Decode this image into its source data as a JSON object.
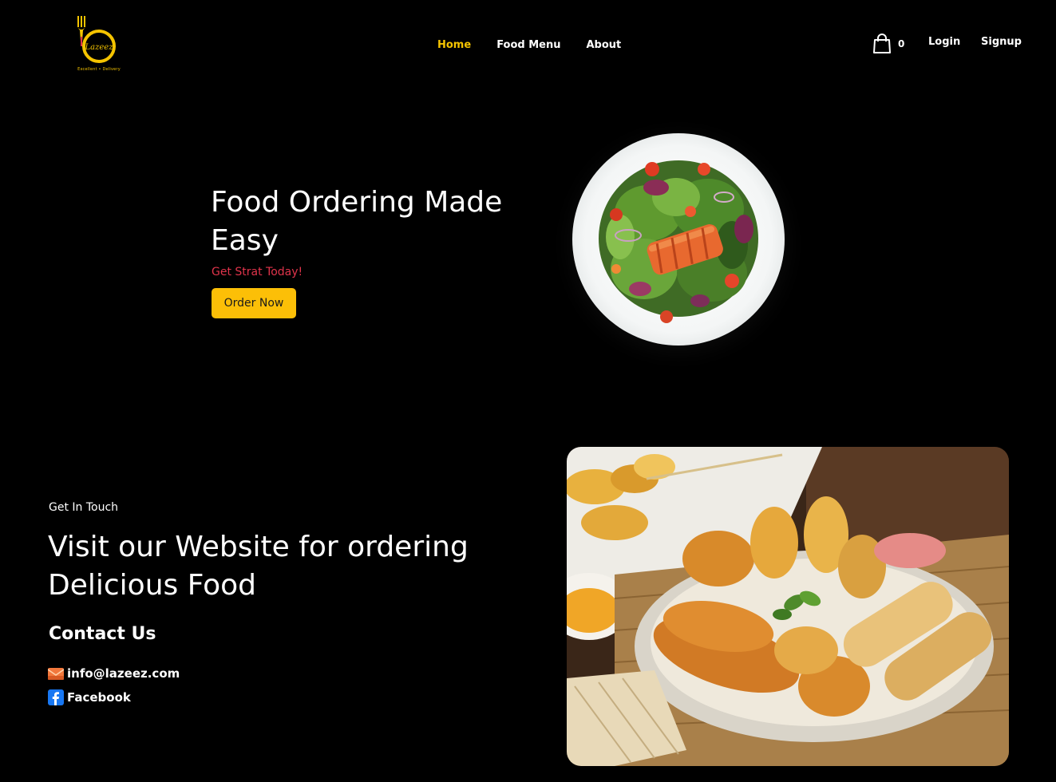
{
  "nav": {
    "logo_text": "Lazeez",
    "logo_tagline": "Excellent • Delivery",
    "links": [
      {
        "label": "Home",
        "active": true
      },
      {
        "label": "Food Menu",
        "active": false
      },
      {
        "label": "About",
        "active": false
      }
    ],
    "cart_count": "0",
    "login": "Login",
    "signup": "Signup"
  },
  "hero": {
    "title": "Food Ordering Made Easy",
    "subtitle": "Get Strat Today!",
    "cta": "Order Now",
    "image_icon": "salad-plate-image"
  },
  "contact_section": {
    "kicker": "Get In Touch",
    "title": "Visit our Website for ordering Delicious Food",
    "contact_heading": "Contact Us",
    "email": "info@lazeez.com",
    "facebook": "Facebook",
    "image_icon": "fried-food-platter-image"
  },
  "colors": {
    "background": "#000000",
    "accent": "#fcbf07",
    "active_link": "#f5c400",
    "subtitle_red": "#e0344b",
    "facebook_blue": "#1877f2",
    "email_orange": "#f2783c"
  }
}
